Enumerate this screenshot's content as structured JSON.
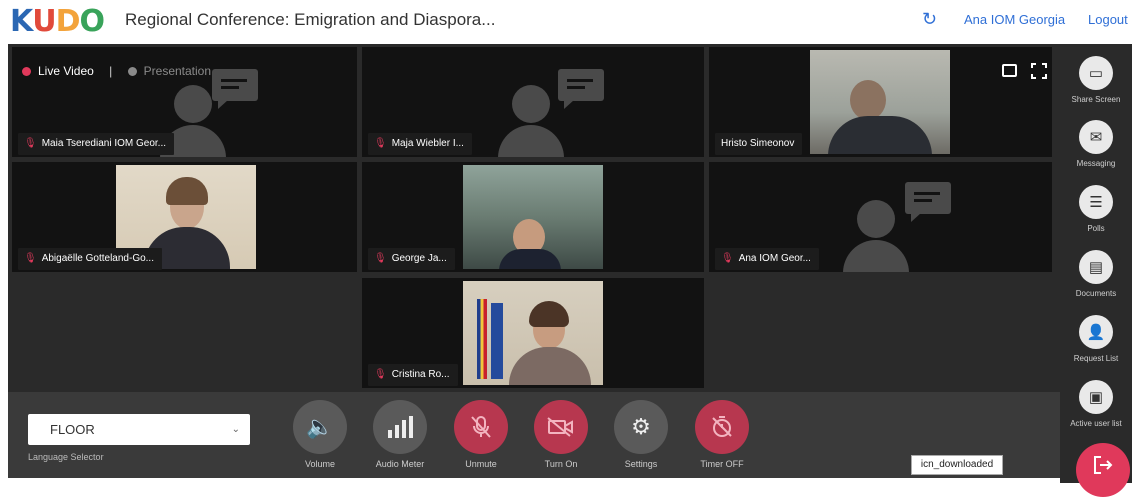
{
  "header": {
    "logo_letters": [
      "K",
      "U",
      "D",
      "O"
    ],
    "logo_colors": [
      "#2b67b3",
      "#e14a3b",
      "#f3a33b",
      "#39a35a"
    ],
    "title": "Regional Conference: Emigration and Diaspora...",
    "refresh_icon": "refresh-icon",
    "user": "Ana IOM Georgia",
    "logout": "Logout"
  },
  "view_mode": {
    "live": "Live Video",
    "separator": "|",
    "presentation": "Presentation",
    "live_color": "#e0395b"
  },
  "tiles": [
    {
      "name": "Maia Tserediani IOM Geor...",
      "video": false
    },
    {
      "name": "Maja Wiebler I...",
      "video": false
    },
    {
      "name": "Hristo Simeonov",
      "video": true
    },
    {
      "name": "Abigaëlle Gotteland-Go...",
      "video": true
    },
    {
      "name": "George Ja...",
      "video": true
    },
    {
      "name": "Ana IOM Geor...",
      "video": false
    },
    {
      "name": "Cristina Ro...",
      "video": true
    }
  ],
  "sidebar": [
    {
      "label": "Share Screen",
      "icon": "share-screen-icon"
    },
    {
      "label": "Messaging",
      "icon": "messaging-icon"
    },
    {
      "label": "Polls",
      "icon": "polls-icon"
    },
    {
      "label": "Documents",
      "icon": "documents-icon"
    },
    {
      "label": "Request List",
      "icon": "request-list-icon"
    },
    {
      "label": "Active user list",
      "icon": "active-user-list-icon"
    }
  ],
  "controls": {
    "language_value": "FLOOR",
    "language_label": "Language Selector",
    "buttons": [
      {
        "label": "Volume",
        "icon": "volume-icon"
      },
      {
        "label": "Audio Meter",
        "icon": "audio-meter-icon"
      },
      {
        "label": "Unmute",
        "icon": "mic-off-icon"
      },
      {
        "label": "Turn On",
        "icon": "camera-off-icon"
      },
      {
        "label": "Settings",
        "icon": "gear-icon"
      },
      {
        "label": "Timer OFF",
        "icon": "timer-off-icon"
      }
    ]
  },
  "tooltip": "icn_downloaded",
  "exit_icon": "exit-icon"
}
